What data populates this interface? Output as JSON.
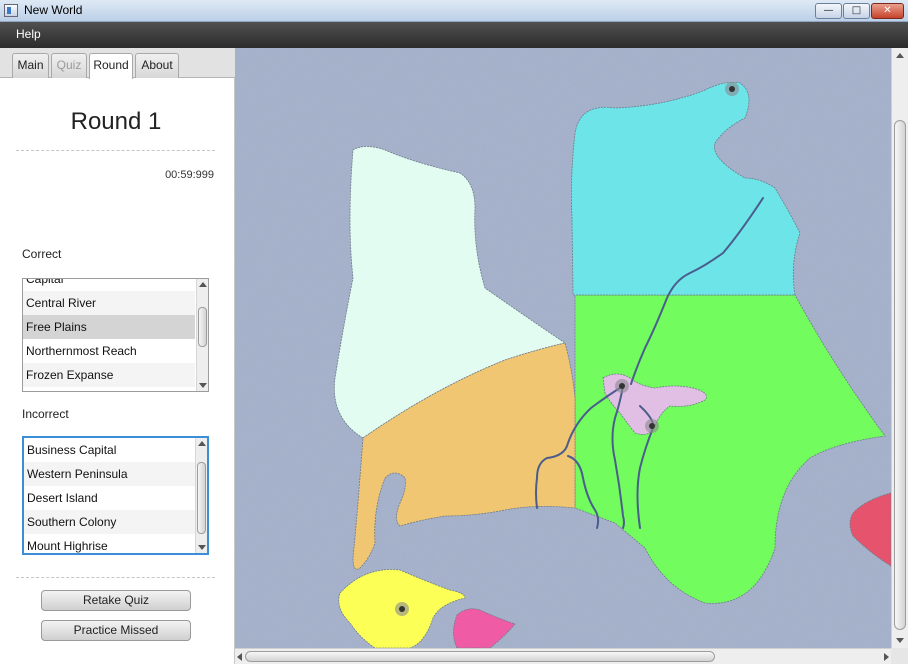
{
  "window": {
    "title": "New World"
  },
  "menu": {
    "items": [
      "Help"
    ]
  },
  "tabs": [
    {
      "label": "Main",
      "state": "normal"
    },
    {
      "label": "Quiz",
      "state": "disabled"
    },
    {
      "label": "Round",
      "state": "active"
    },
    {
      "label": "About",
      "state": "normal"
    }
  ],
  "round": {
    "title": "Round 1",
    "timer": "00:59:999"
  },
  "correct": {
    "label": "Correct",
    "items": [
      "Capital",
      "Central River",
      "Free Plains",
      "Northernmost Reach",
      "Frozen Expanse"
    ],
    "selected": "Free Plains"
  },
  "incorrect": {
    "label": "Incorrect",
    "items": [
      "Business Capital",
      "Western Peninsula",
      "Desert Island",
      "Southern Colony",
      "Mount Highrise"
    ]
  },
  "buttons": {
    "retake": "Retake Quiz",
    "practice": "Practice Missed"
  },
  "map": {
    "colors": {
      "ocean": "#a4b0cb",
      "northern_region": "#6ce4e8",
      "frozen_region": "#e2fcf1",
      "green_plains": "#72fc5e",
      "desert_region": "#f0c672",
      "lavender_area": "#e1bfe4",
      "yellow_island": "#fbff56",
      "pink_island": "#f05ba5",
      "red_region": "#e5536c",
      "river": "#4b5d8c"
    }
  }
}
